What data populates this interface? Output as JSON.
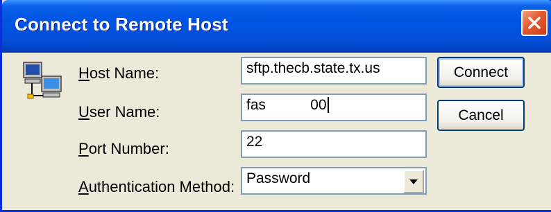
{
  "window": {
    "title": "Connect to Remote Host",
    "close_icon": "close-icon"
  },
  "form": {
    "host_name": {
      "label_prefix": "H",
      "label_rest": "ost Name:",
      "value": "sftp.thecb.state.tx.us"
    },
    "user_name": {
      "label_prefix": "U",
      "label_rest": "ser Name:",
      "value": "fas           00"
    },
    "port_number": {
      "label_prefix": "P",
      "label_rest": "ort Number:",
      "value": "22"
    },
    "auth_method": {
      "label_prefix": "A",
      "label_rest": "uthentication Method:",
      "value": "Password"
    }
  },
  "buttons": {
    "connect": "Connect",
    "cancel": "Cancel"
  },
  "icons": {
    "host": "network-computers-icon",
    "dropdown": "chevron-down-icon"
  },
  "colors": {
    "titlebar": "#0054e3",
    "close": "#e5582f",
    "face": "#ece9d8"
  }
}
